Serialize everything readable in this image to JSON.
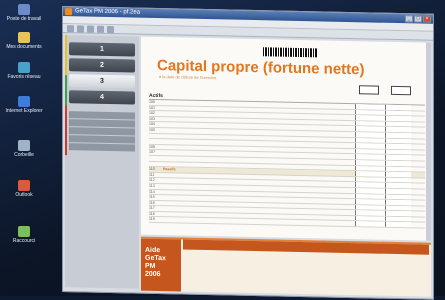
{
  "window": {
    "title": "GeTax PM 2006 - pf.2ea"
  },
  "desktop_icons": [
    {
      "label": "Poste de travail"
    },
    {
      "label": "Mes documents"
    },
    {
      "label": "Favoris réseau"
    },
    {
      "label": "Internet Explorer"
    },
    {
      "label": "Corbeille"
    },
    {
      "label": "Outlook"
    },
    {
      "label": "Raccourci"
    }
  ],
  "sidebar": {
    "tabs": [
      {
        "label": "1"
      },
      {
        "label": "2"
      },
      {
        "label": "3"
      },
      {
        "label": "4"
      }
    ],
    "buttons": [
      "",
      "",
      "",
      "",
      ""
    ]
  },
  "form": {
    "barcode_number": "",
    "title": "Capital propre (fortune nette)",
    "subtitle": "à la date de clôture de l'exercice",
    "year_col1": "",
    "year_col2": "",
    "header": "Actifs",
    "rows": [
      {
        "code": "100",
        "text": ""
      },
      {
        "code": "101",
        "text": ""
      },
      {
        "code": "102",
        "text": ""
      },
      {
        "code": "103",
        "text": ""
      },
      {
        "code": "104",
        "text": ""
      },
      {
        "code": "105",
        "text": ""
      },
      {
        "code": "",
        "text": ""
      },
      {
        "code": "",
        "text": ""
      },
      {
        "code": "106",
        "text": ""
      },
      {
        "code": "107",
        "text": ""
      },
      {
        "code": "",
        "text": ""
      },
      {
        "code": "",
        "text": ""
      },
      {
        "code": "110",
        "text": "Passifs"
      },
      {
        "code": "111",
        "text": ""
      },
      {
        "code": "112",
        "text": ""
      },
      {
        "code": "113",
        "text": ""
      },
      {
        "code": "114",
        "text": ""
      },
      {
        "code": "115",
        "text": ""
      },
      {
        "code": "116",
        "text": ""
      },
      {
        "code": "117",
        "text": ""
      },
      {
        "code": "118",
        "text": ""
      },
      {
        "code": "119",
        "text": ""
      }
    ]
  },
  "help": {
    "label_line1": "Aide",
    "label_line2": "GeTax PM",
    "label_line3": "2006",
    "top_text": "",
    "lines": [
      "",
      "",
      "",
      "",
      "",
      "",
      ""
    ]
  }
}
